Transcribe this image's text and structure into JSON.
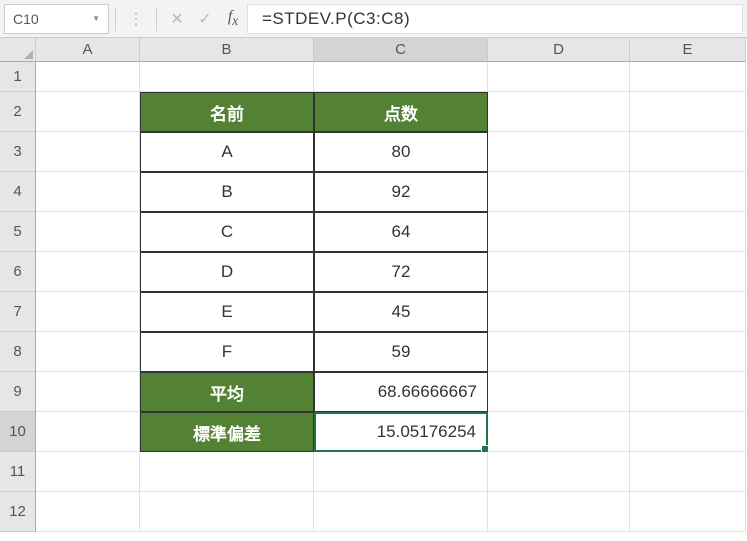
{
  "nameBox": "C10",
  "formula": "=STDEV.P(C3:C8)",
  "columns": [
    "A",
    "B",
    "C",
    "D",
    "E"
  ],
  "rows": [
    "1",
    "2",
    "3",
    "4",
    "5",
    "6",
    "7",
    "8",
    "9",
    "10",
    "11",
    "12"
  ],
  "activeColumn": "C",
  "activeRow": "10",
  "table": {
    "headers": {
      "name": "名前",
      "score": "点数"
    },
    "data": [
      {
        "name": "A",
        "score": "80"
      },
      {
        "name": "B",
        "score": "92"
      },
      {
        "name": "C",
        "score": "64"
      },
      {
        "name": "D",
        "score": "72"
      },
      {
        "name": "E",
        "score": "45"
      },
      {
        "name": "F",
        "score": "59"
      }
    ],
    "summary": {
      "avgLabel": "平均",
      "avgValue": "68.66666667",
      "stdevLabel": "標準偏差",
      "stdevValue": "15.05176254"
    }
  },
  "chart_data": {
    "type": "table",
    "title": "Name-Score table with average and standard deviation",
    "columns": [
      "名前",
      "点数"
    ],
    "rows": [
      [
        "A",
        80
      ],
      [
        "B",
        92
      ],
      [
        "C",
        64
      ],
      [
        "D",
        72
      ],
      [
        "E",
        45
      ],
      [
        "F",
        59
      ]
    ],
    "summary": {
      "平均": 68.66666667,
      "標準偏差": 15.05176254
    }
  }
}
